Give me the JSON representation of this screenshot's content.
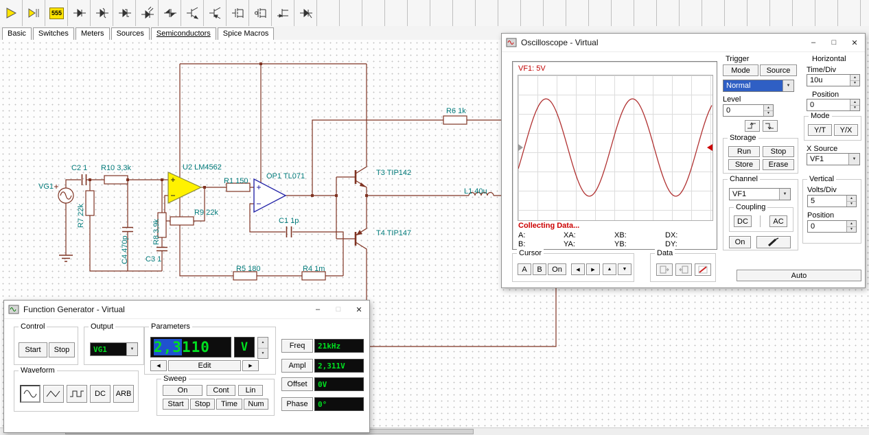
{
  "toolbar": {
    "timer_label": "555",
    "tabs": [
      "Basic",
      "Switches",
      "Meters",
      "Sources",
      "Semiconductors",
      "Spice Macros"
    ]
  },
  "icons": {
    "minimize": "–",
    "maximize": "□",
    "close": "✕",
    "arrow_left": "◀",
    "arrow_right": "▶",
    "arrow_up": "▲",
    "arrow_down": "▼"
  },
  "circuit": {
    "labels": {
      "vg1": "VG1",
      "c2": "C2 1",
      "r10": "R10 3,3k",
      "r7": "R7 22k",
      "c4": "C4 470p",
      "c3": "C3 1",
      "r8": "R8 3,9k",
      "u2": "U2 LM4562",
      "r9": "R9 22k",
      "r1": "R1 150",
      "op1": "OP1 TL071",
      "c1": "C1 1p",
      "r5": "R5 180",
      "r4": "R4 1m",
      "t3": "T3 TIP142",
      "t4": "T4 TIP147",
      "r6": "R6 1k",
      "l1": "L1 40u"
    }
  },
  "oscilloscope": {
    "title": "Oscilloscope - Virtual",
    "display": {
      "signal": "VF1: 5V",
      "status": "Collecting Data...",
      "row1": [
        "A:",
        "XA:",
        "XB:",
        "DX:"
      ],
      "row2": [
        "B:",
        "YA:",
        "YB:",
        "DY:"
      ]
    },
    "trigger": {
      "label": "Trigger",
      "mode": "Mode",
      "source": "Source",
      "mode_value": "Normal",
      "level_label": "Level",
      "level_value": "0"
    },
    "storage": {
      "label": "Storage",
      "run": "Run",
      "stop": "Stop",
      "store": "Store",
      "erase": "Erase"
    },
    "channel": {
      "label": "Channel",
      "value": "VF1",
      "coupling_label": "Coupling",
      "dc": "DC",
      "ac": "AC",
      "on": "On"
    },
    "horizontal": {
      "label": "Horizontal",
      "time_div_label": "Time/Div",
      "time_div": "10u",
      "position_label": "Position",
      "position": "0",
      "mode_label": "Mode",
      "yt": "Y/T",
      "yx": "Y/X",
      "xsource_label": "X Source",
      "xsource": "VF1"
    },
    "vertical": {
      "label": "Vertical",
      "volts_div_label": "Volts/Div",
      "volts_div": "5",
      "position_label": "Position",
      "position": "0"
    },
    "cursor": {
      "label": "Cursor",
      "a": "A",
      "b": "B",
      "on": "On"
    },
    "data_label": "Data",
    "auto": "Auto"
  },
  "function_generator": {
    "title": "Function Generator - Virtual",
    "control": {
      "label": "Control",
      "start": "Start",
      "stop": "Stop"
    },
    "output": {
      "label": "Output",
      "value": "VG1"
    },
    "waveform": {
      "label": "Waveform",
      "dc": "DC",
      "arb": "ARB"
    },
    "parameters": {
      "label": "Parameters",
      "value_selected": "2,3",
      "value_rest": "110",
      "unit": "V",
      "edit": "Edit"
    },
    "sweep": {
      "label": "Sweep",
      "on": "On",
      "cont": "Cont",
      "lin": "Lin",
      "start": "Start",
      "stop": "Stop",
      "time": "Time",
      "num": "Num"
    },
    "fields": [
      {
        "label": "Freq",
        "value": "21kHz"
      },
      {
        "label": "Ampl",
        "value": "2,311V"
      },
      {
        "label": "Offset",
        "value": "0V"
      },
      {
        "label": "Phase",
        "value": "0°"
      }
    ]
  }
}
